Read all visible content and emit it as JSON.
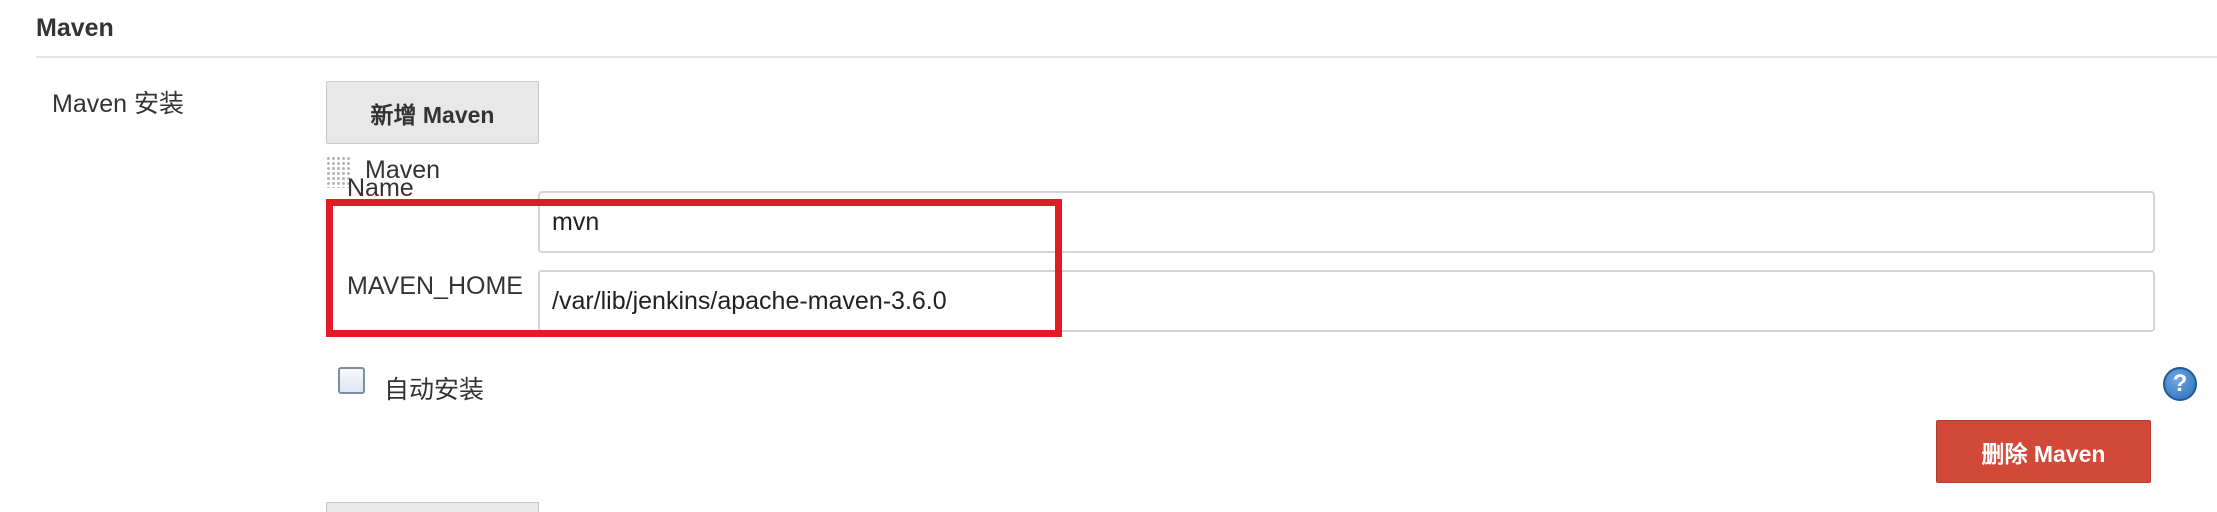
{
  "section": {
    "title": "Maven"
  },
  "installations": {
    "label": "Maven 安装",
    "add_button_label": "新增 Maven",
    "group_title": "Maven",
    "fields": [
      {
        "label": "Name",
        "value": "mvn"
      },
      {
        "label": "MAVEN_HOME",
        "value": "/var/lib/jenkins/apache-maven-3.6.0"
      }
    ],
    "auto_install": {
      "label": "自动安装",
      "checked": false
    },
    "help_icon": "help-question-icon",
    "delete_button_label": "删除 Maven"
  },
  "colors": {
    "highlight": "#e11b26",
    "delete_button": "#d24939",
    "add_button": "#e8e8e8"
  }
}
